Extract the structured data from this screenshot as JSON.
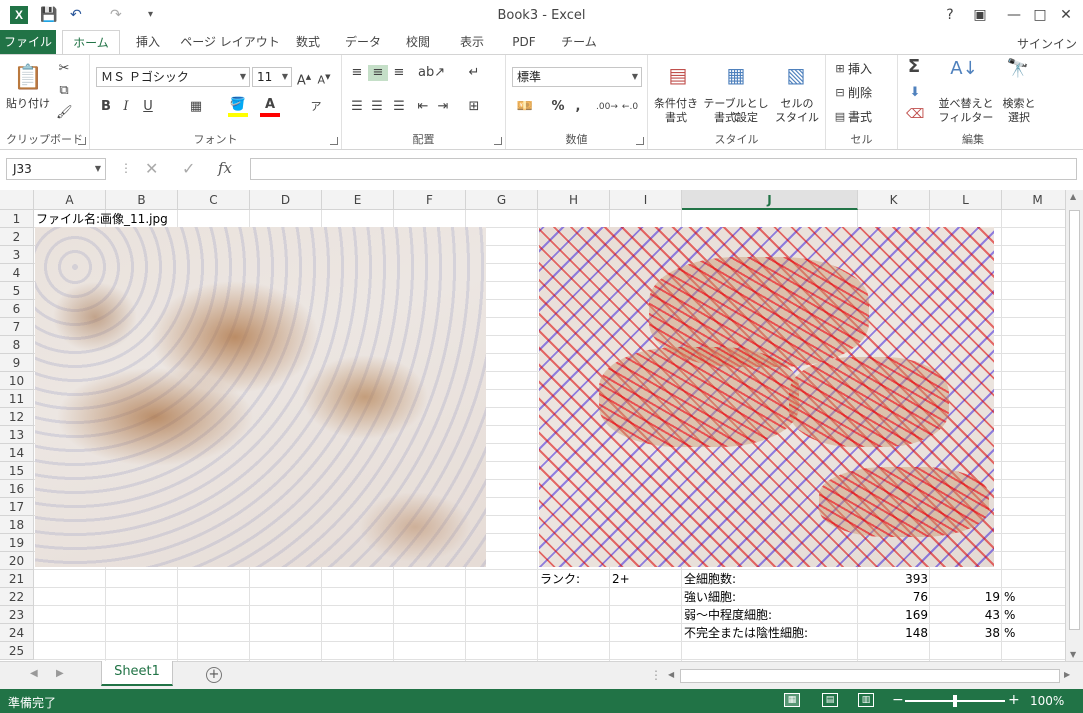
{
  "app": {
    "window_title": "Book3 - Excel",
    "logo_glyph": "X",
    "colors": {
      "accent": "#217346",
      "selection": "#217346"
    }
  },
  "window_controls": {
    "help": "?",
    "restore_ribbon": "▣",
    "minimize": "—",
    "maximize": "□",
    "close": "✕"
  },
  "quick_access": {
    "save": "💾",
    "undo": "↶",
    "redo": "↷",
    "customize": "▾"
  },
  "tabs": [
    {
      "label": "ファイル"
    },
    {
      "label": "ホーム"
    },
    {
      "label": "挿入"
    },
    {
      "label": "ページ レイアウト"
    },
    {
      "label": "数式"
    },
    {
      "label": "データ"
    },
    {
      "label": "校閲"
    },
    {
      "label": "表示"
    },
    {
      "label": "PDF"
    },
    {
      "label": "チーム"
    }
  ],
  "signin": "サインイン",
  "ribbon": {
    "clipboard": {
      "label": "クリップボード",
      "paste": "貼り付け"
    },
    "font": {
      "label": "フォント",
      "font_name": "ＭＳ Ｐゴシック",
      "font_size": "11",
      "bold": "B",
      "italic": "I",
      "underline": "U"
    },
    "alignment": {
      "label": "配置"
    },
    "number": {
      "label": "数値",
      "format": "標準",
      "percent": "%",
      "comma": ","
    },
    "styles": {
      "label": "スタイル",
      "conditional_1": "条件付き",
      "conditional_2": "書式",
      "table_1": "テーブルとして",
      "table_2": "書式設定",
      "cell_1": "セルの",
      "cell_2": "スタイル"
    },
    "cells": {
      "label": "セル",
      "insert": "挿入",
      "delete": "削除",
      "format": "書式"
    },
    "editing": {
      "label": "編集",
      "sort_1": "並べ替えと",
      "sort_2": "フィルター",
      "find_1": "検索と",
      "find_2": "選択",
      "sum": "Σ"
    }
  },
  "formula_bar": {
    "name_box": "J33",
    "fx": "fx",
    "cancel": "✕",
    "enter": "✓",
    "value": ""
  },
  "grid": {
    "columns": [
      "A",
      "B",
      "C",
      "D",
      "E",
      "F",
      "G",
      "H",
      "I",
      "J",
      "K",
      "L",
      "M"
    ],
    "selected_column": "J",
    "rows": [
      "1",
      "2",
      "3",
      "4",
      "5",
      "6",
      "7",
      "8",
      "9",
      "10",
      "11",
      "12",
      "13",
      "14",
      "15",
      "16",
      "17",
      "18",
      "19",
      "20",
      "21",
      "22",
      "23",
      "24",
      "25"
    ],
    "cells": {
      "a1": "ファイル名:画像_11.jpg",
      "h21": "ランク:",
      "i21": "2+",
      "j21": "全細胞数:",
      "k21": "393",
      "j22": "強い細胞:",
      "k22": "76",
      "l22": "19",
      "m22": "%",
      "j23": "弱～中程度細胞:",
      "k23": "169",
      "l23": "43",
      "m23": "%",
      "j24": "不完全または陰性細胞:",
      "k24": "148",
      "l24": "38",
      "m24": "%"
    }
  },
  "sheets": [
    {
      "label": "Sheet1"
    }
  ],
  "add_sheet": "+",
  "status": {
    "ready": "準備完了",
    "zoom": "100%",
    "zoom_minus": "−",
    "zoom_plus": "+",
    "zoom_fraction": 0.5
  }
}
